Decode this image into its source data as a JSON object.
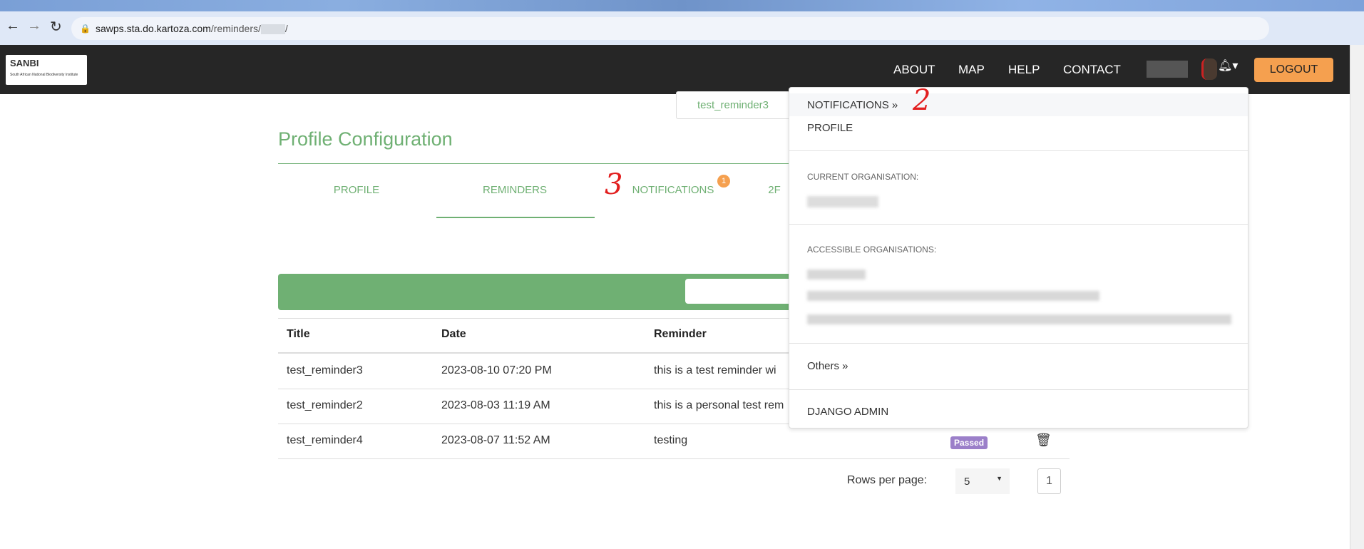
{
  "browser": {
    "url_host": "sawps.sta.do.kartoza.com",
    "url_path": "/reminders/",
    "url_tail": "/"
  },
  "navbar": {
    "logo_text": "SANBI",
    "logo_subtitle": "South African National Biodiversity Institute",
    "links": [
      "ABOUT",
      "MAP",
      "HELP",
      "CONTACT"
    ],
    "logout": "LOGOUT"
  },
  "page": {
    "title": "Profile Configuration",
    "tabs": [
      "PROFILE",
      "REMINDERS",
      "NOTIFICATIONS",
      "2F"
    ],
    "active_tab": "REMINDERS",
    "notification_count": "1"
  },
  "tooltip": "test_reminder3",
  "table": {
    "headers": [
      "Title",
      "Date",
      "Reminder"
    ],
    "rows": [
      {
        "title": "test_reminder3",
        "date": "2023-08-10 07:20 PM",
        "reminder": "this is a test reminder wi"
      },
      {
        "title": "test_reminder2",
        "date": "2023-08-03 11:19 AM",
        "reminder": "this is a personal test rem"
      },
      {
        "title": "test_reminder4",
        "date": "2023-08-07 11:52 AM",
        "reminder": "testing",
        "status": "Passed"
      }
    ]
  },
  "pagination": {
    "rows_per_page_label": "Rows per page:",
    "rows_per_page": "5",
    "page": "1"
  },
  "dropdown": {
    "notifications": "NOTIFICATIONS »",
    "profile": "PROFILE",
    "current_org_label": "CURRENT ORGANISATION:",
    "accessible_org_label": "ACCESSIBLE ORGANISATIONS:",
    "others": "Others »",
    "django_admin": "DJANGO ADMIN"
  },
  "annotations": [
    "2",
    "3"
  ],
  "colors": {
    "accent": "#6fb073",
    "logout": "#f5a04f",
    "navbar": "#262626",
    "passed": "#9b7fc9"
  }
}
